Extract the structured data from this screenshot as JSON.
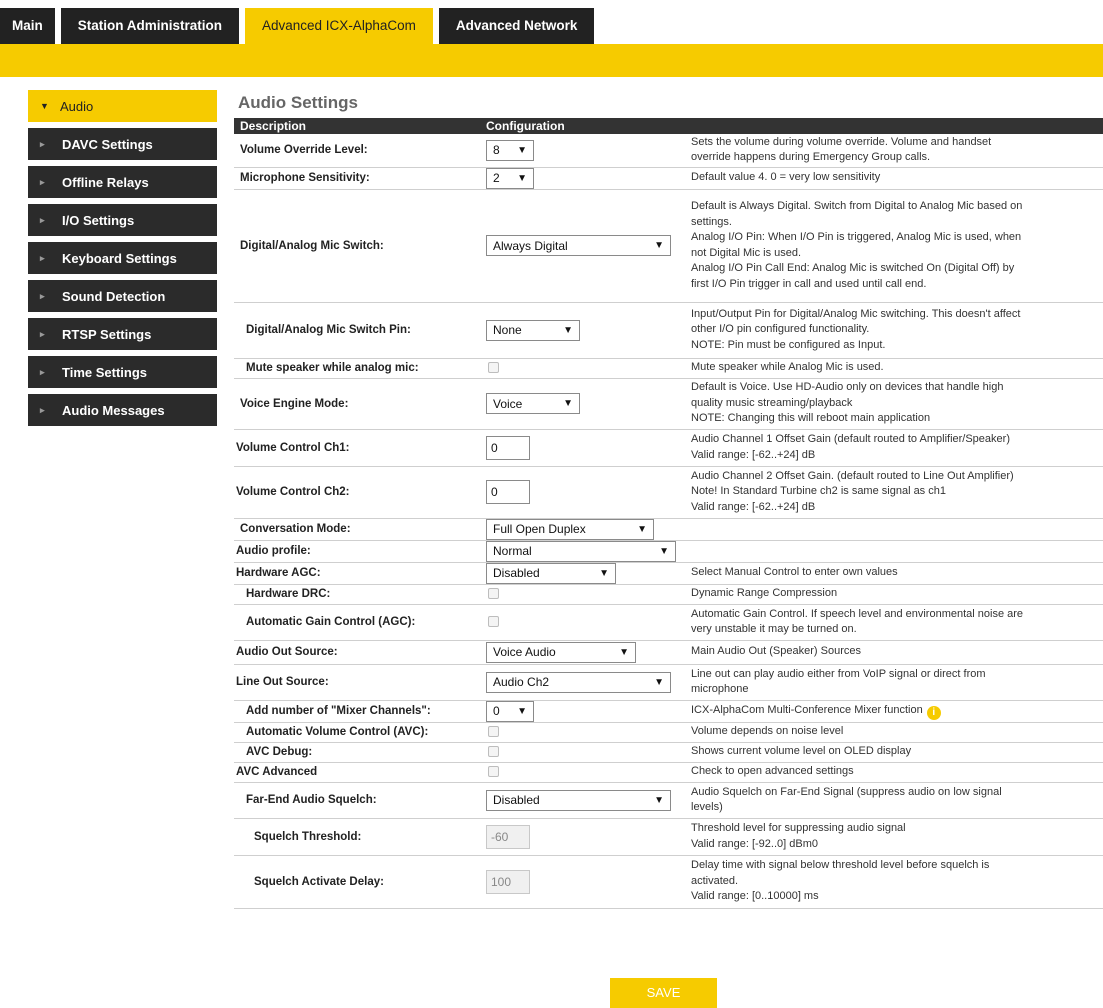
{
  "tabs": [
    {
      "label": "Main"
    },
    {
      "label": "Station Administration"
    },
    {
      "label": "Advanced ICX-AlphaCom"
    },
    {
      "label": "Advanced Network"
    }
  ],
  "sidebar": {
    "items": [
      {
        "label": "Audio"
      },
      {
        "label": "DAVC Settings"
      },
      {
        "label": "Offline Relays"
      },
      {
        "label": "I/O Settings"
      },
      {
        "label": "Keyboard Settings"
      },
      {
        "label": "Sound Detection"
      },
      {
        "label": "RTSP Settings"
      },
      {
        "label": "Time Settings"
      },
      {
        "label": "Audio Messages"
      }
    ]
  },
  "main": {
    "title": "Audio Settings",
    "columns": {
      "description": "Description",
      "configuration": "Configuration"
    },
    "rows": {
      "volume_override": {
        "label": "Volume Override Level:",
        "value": "8",
        "help": [
          "Sets the volume during volume override. Volume and handset",
          "override happens during Emergency Group calls."
        ]
      },
      "mic_sensitivity": {
        "label": "Microphone Sensitivity:",
        "value": "2",
        "help": [
          "Default value 4. 0 = very low sensitivity"
        ]
      },
      "mic_switch": {
        "label": "Digital/Analog Mic Switch:",
        "value": "Always Digital",
        "help": [
          "Default is Always Digital. Switch from Digital to Analog Mic based on",
          "settings.",
          "Analog I/O Pin: When I/O Pin is triggered, Analog Mic is used, when",
          "not Digital Mic is used.",
          "Analog I/O Pin Call End: Analog Mic is switched On (Digital Off) by",
          "first I/O Pin trigger in call and used until call end."
        ]
      },
      "mic_switch_pin": {
        "label": "Digital/Analog Mic Switch Pin:",
        "value": "None",
        "help": [
          "Input/Output Pin for Digital/Analog Mic switching. This doesn't affect",
          "other I/O pin configured functionality.",
          "NOTE: Pin must be configured as Input."
        ]
      },
      "mute_speaker": {
        "label": "Mute speaker while analog mic:",
        "help": [
          "Mute speaker while Analog Mic is used."
        ]
      },
      "voice_engine": {
        "label": "Voice Engine Mode:",
        "value": "Voice",
        "help": [
          "Default is Voice. Use HD-Audio only on devices that handle high",
          "quality music streaming/playback",
          "NOTE: Changing this will reboot main application"
        ]
      },
      "vol_ch1": {
        "label": "Volume Control Ch1:",
        "value": "0",
        "help": [
          "Audio Channel 1 Offset Gain (default routed to Amplifier/Speaker)",
          "Valid range: [-62..+24] dB"
        ]
      },
      "vol_ch2": {
        "label": "Volume Control Ch2:",
        "value": "0",
        "help": [
          "Audio Channel 2 Offset Gain. (default routed to Line Out Amplifier)",
          "Note! In Standard Turbine ch2 is same signal as ch1",
          "Valid range: [-62..+24] dB"
        ]
      },
      "conversation_mode": {
        "label": "Conversation Mode:",
        "value": "Full Open Duplex"
      },
      "audio_profile": {
        "label": "Audio profile:",
        "value": "Normal"
      },
      "hw_agc": {
        "label": "Hardware AGC:",
        "value": "Disabled",
        "help": [
          "Select Manual Control to enter own values"
        ]
      },
      "hw_drc": {
        "label": "Hardware DRC:",
        "help": [
          "Dynamic Range Compression"
        ]
      },
      "agc": {
        "label": "Automatic Gain Control (AGC):",
        "help": [
          "Automatic Gain Control. If speech level and environmental noise are",
          "very unstable it may be turned on."
        ]
      },
      "audio_out_source": {
        "label": "Audio Out Source:",
        "value": "Voice Audio",
        "help": [
          "Main Audio Out (Speaker) Sources"
        ]
      },
      "line_out_source": {
        "label": "Line Out Source:",
        "value": "Audio Ch2",
        "help": [
          "Line out can play audio either from VoIP signal or direct from",
          "microphone"
        ]
      },
      "mixer_channels": {
        "label": "Add number of \"Mixer Channels\":",
        "value": "0",
        "help": [
          "ICX-AlphaCom Multi-Conference Mixer function"
        ],
        "info_glyph": "i"
      },
      "avc": {
        "label": "Automatic Volume Control (AVC):",
        "help": [
          "Volume depends on noise level"
        ]
      },
      "avc_debug": {
        "label": "AVC Debug:",
        "help": [
          "Shows current volume level on OLED display"
        ]
      },
      "avc_advanced": {
        "label": "AVC Advanced",
        "help": [
          "Check to open advanced settings"
        ]
      },
      "squelch": {
        "label": "Far-End Audio Squelch:",
        "value": "Disabled",
        "help": [
          "Audio Squelch on Far-End Signal (suppress audio on low signal",
          "levels)"
        ]
      },
      "squelch_threshold": {
        "label": "Squelch Threshold:",
        "value": "-60",
        "help": [
          "Threshold level for suppressing audio signal",
          "Valid range: [-92..0] dBm0"
        ]
      },
      "squelch_delay": {
        "label": "Squelch Activate Delay:",
        "value": "100",
        "help": [
          "Delay time with signal below threshold level before squelch is",
          "activated.",
          "Valid range: [0..10000] ms"
        ]
      }
    },
    "save_label": "SAVE"
  },
  "icons": {
    "sidebar_chevron": "chevron-right-icon",
    "active_chevron": "chevron-down-icon",
    "select_arrow": "caret-down-icon",
    "info": "info-icon"
  },
  "colors": {
    "accent": "#f6cb00",
    "nav_dark": "#2b2b2b",
    "header_dark": "#333333"
  }
}
